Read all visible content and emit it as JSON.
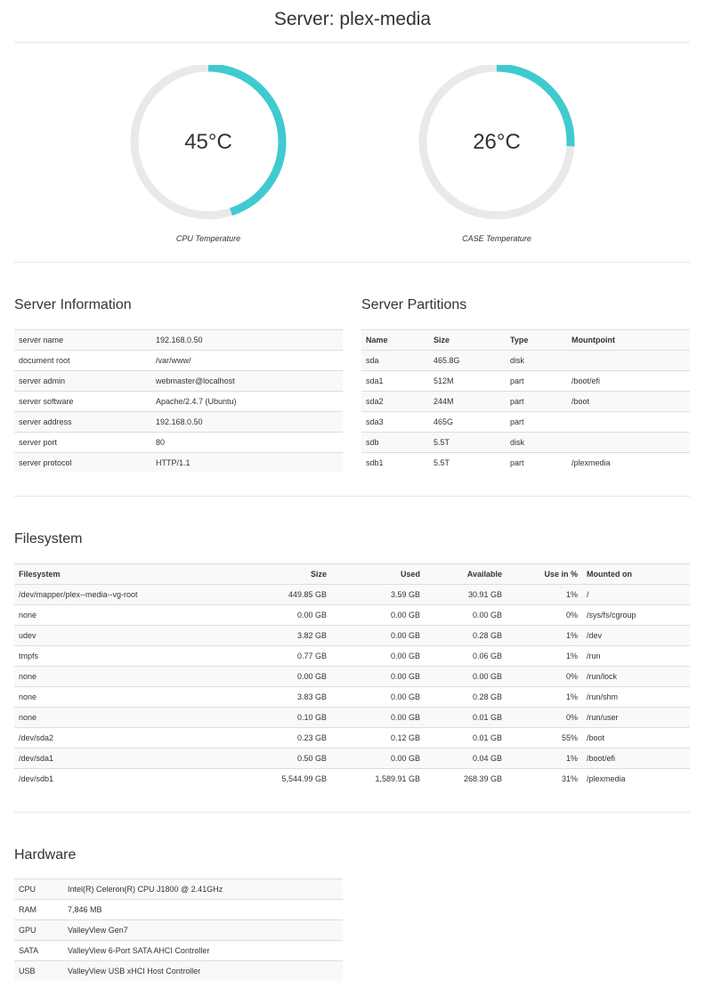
{
  "page": {
    "title": "Server: plex-media"
  },
  "gauges": [
    {
      "value": "45°C",
      "caption": "CPU Temperature",
      "fraction": 0.45,
      "color": "#3fcad0"
    },
    {
      "value": "26°C",
      "caption": "CASE Temperature",
      "fraction": 0.26,
      "color": "#3fcad0"
    }
  ],
  "server_info": {
    "title": "Server Information",
    "rows": [
      [
        "server name",
        "192.168.0.50"
      ],
      [
        "document root",
        "/var/www/"
      ],
      [
        "server admin",
        "webmaster@localhost"
      ],
      [
        "server software",
        "Apache/2.4.7 (Ubuntu)"
      ],
      [
        "server address",
        "192.168.0.50"
      ],
      [
        "server port",
        "80"
      ],
      [
        "server protocol",
        "HTTP/1.1"
      ]
    ]
  },
  "partitions": {
    "title": "Server Partitions",
    "headers": [
      "Name",
      "Size",
      "Type",
      "Mountpoint"
    ],
    "rows": [
      [
        "sda",
        "465.8G",
        "disk",
        ""
      ],
      [
        "sda1",
        "512M",
        "part",
        "/boot/efi"
      ],
      [
        "sda2",
        "244M",
        "part",
        "/boot"
      ],
      [
        "sda3",
        "465G",
        "part",
        ""
      ],
      [
        "sdb",
        "5.5T",
        "disk",
        ""
      ],
      [
        "sdb1",
        "5.5T",
        "part",
        "/plexmedia"
      ]
    ]
  },
  "filesystem": {
    "title": "Filesystem",
    "headers": [
      "Filesystem",
      "Size",
      "Used",
      "Available",
      "Use in %",
      "Mounted on"
    ],
    "rows": [
      [
        "/dev/mapper/plex--media--vg-root",
        "449.85 GB",
        "3.59 GB",
        "30.91 GB",
        "1%",
        "/"
      ],
      [
        "none",
        "0.00 GB",
        "0.00 GB",
        "0.00 GB",
        "0%",
        "/sys/fs/cgroup"
      ],
      [
        "udev",
        "3.82 GB",
        "0.00 GB",
        "0.28 GB",
        "1%",
        "/dev"
      ],
      [
        "tmpfs",
        "0.77 GB",
        "0.00 GB",
        "0.06 GB",
        "1%",
        "/run"
      ],
      [
        "none",
        "0.00 GB",
        "0.00 GB",
        "0.00 GB",
        "0%",
        "/run/lock"
      ],
      [
        "none",
        "3.83 GB",
        "0.00 GB",
        "0.28 GB",
        "1%",
        "/run/shm"
      ],
      [
        "none",
        "0.10 GB",
        "0.00 GB",
        "0.01 GB",
        "0%",
        "/run/user"
      ],
      [
        "/dev/sda2",
        "0.23 GB",
        "0.12 GB",
        "0.01 GB",
        "55%",
        "/boot"
      ],
      [
        "/dev/sda1",
        "0.50 GB",
        "0.00 GB",
        "0.04 GB",
        "1%",
        "/boot/efi"
      ],
      [
        "/dev/sdb1",
        "5,544.99 GB",
        "1,589.91 GB",
        "268.39 GB",
        "31%",
        "/plexmedia"
      ]
    ]
  },
  "hardware": {
    "title": "Hardware",
    "rows": [
      [
        "CPU",
        "Intel(R) Celeron(R) CPU J1800 @ 2.41GHz"
      ],
      [
        "RAM",
        "7,846 MB"
      ],
      [
        "GPU",
        "ValleyView Gen7"
      ],
      [
        "SATA",
        "ValleyView 6-Port SATA AHCI Controller"
      ],
      [
        "USB",
        "ValleyView USB xHCI Host Controller"
      ]
    ]
  }
}
